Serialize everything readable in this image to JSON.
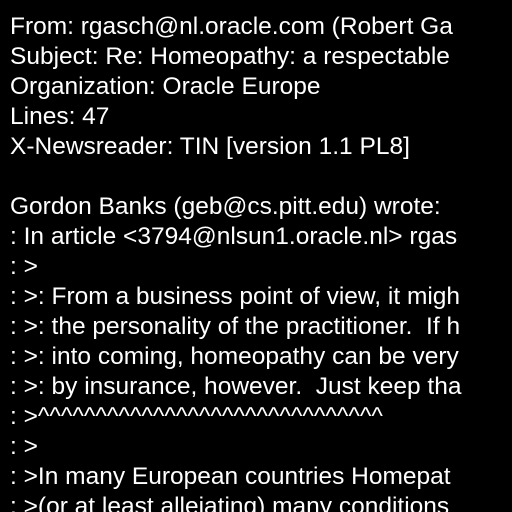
{
  "colors": {
    "background": "#000000",
    "text": "#ffffff"
  },
  "message": {
    "lines": [
      "From: rgasch@nl.oracle.com (Robert Ga",
      "Subject: Re: Homeopathy: a respectable",
      "Organization: Oracle Europe",
      "Lines: 47",
      "X-Newsreader: TIN [version 1.1 PL8]",
      "",
      "Gordon Banks (geb@cs.pitt.edu) wrote:",
      ": In article <3794@nlsun1.oracle.nl> rgas",
      ": >",
      ": >: From a business point of view, it migh",
      ": >: the personality of the practitioner.  If h",
      ": >: into coming, homeopathy can be very",
      ": >: by insurance, however.  Just keep tha",
      ": >^^^^^^^^^^^^^^^^^^^^^^^^^^^^^^",
      ": >",
      ": >In many European countries Homepat",
      ": >(or at least alleiating) many conditions"
    ]
  }
}
